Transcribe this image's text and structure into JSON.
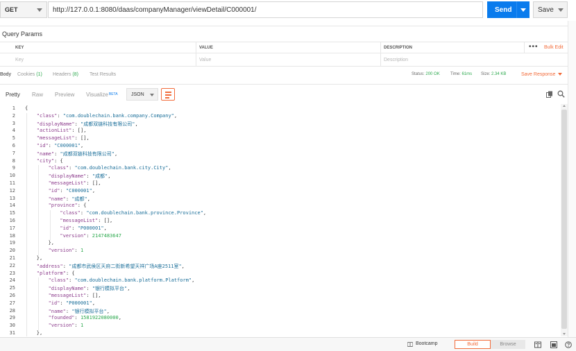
{
  "request": {
    "method": "GET",
    "url": "http://127.0.0.1:8080/daas/companyManager/viewDetail/C000001/",
    "send_label": "Send",
    "save_label": "Save"
  },
  "params": {
    "title": "Query Params",
    "columns": [
      "KEY",
      "VALUE",
      "DESCRIPTION"
    ],
    "placeholders": [
      "Key",
      "Value",
      "Description"
    ],
    "more": "•••",
    "bulk_edit": "Bulk Edit"
  },
  "response_tabs": {
    "body": "Body",
    "cookies": "Cookies",
    "cookies_count": "(1)",
    "headers": "Headers",
    "headers_count": "(8)",
    "test_results": "Test Results"
  },
  "response_meta": {
    "status_label": "Status:",
    "status_value": "200 OK",
    "time_label": "Time:",
    "time_value": "61ms",
    "size_label": "Size:",
    "size_value": "2.34 KB",
    "save_response": "Save Response"
  },
  "view_modes": {
    "pretty": "Pretty",
    "raw": "Raw",
    "preview": "Preview",
    "visualize": "Visualize",
    "beta": "BETA",
    "format": "JSON"
  },
  "code_lines": [
    {
      "n": "1",
      "indent": 0,
      "parts": [
        [
          "p",
          "{"
        ]
      ]
    },
    {
      "n": "2",
      "indent": 1,
      "parts": [
        [
          "k",
          "\"class\""
        ],
        [
          "p",
          ": "
        ],
        [
          "s",
          "\"com.doublechain.bank.company.Company\""
        ],
        [
          "p",
          ","
        ]
      ]
    },
    {
      "n": "3",
      "indent": 1,
      "parts": [
        [
          "k",
          "\"displayName\""
        ],
        [
          "p",
          ": "
        ],
        [
          "s",
          "\"成都双链科技有限公司\""
        ],
        [
          "p",
          ","
        ]
      ]
    },
    {
      "n": "4",
      "indent": 1,
      "parts": [
        [
          "k",
          "\"actionList\""
        ],
        [
          "p",
          ": [],"
        ]
      ]
    },
    {
      "n": "5",
      "indent": 1,
      "parts": [
        [
          "k",
          "\"messageList\""
        ],
        [
          "p",
          ": [],"
        ]
      ]
    },
    {
      "n": "6",
      "indent": 1,
      "parts": [
        [
          "k",
          "\"id\""
        ],
        [
          "p",
          ": "
        ],
        [
          "s",
          "\"C000001\""
        ],
        [
          "p",
          ","
        ]
      ]
    },
    {
      "n": "7",
      "indent": 1,
      "parts": [
        [
          "k",
          "\"name\""
        ],
        [
          "p",
          ": "
        ],
        [
          "s",
          "\"成都双链科技有限公司\""
        ],
        [
          "p",
          ","
        ]
      ]
    },
    {
      "n": "8",
      "indent": 1,
      "parts": [
        [
          "k",
          "\"city\""
        ],
        [
          "p",
          ": {"
        ]
      ]
    },
    {
      "n": "9",
      "indent": 2,
      "parts": [
        [
          "k",
          "\"class\""
        ],
        [
          "p",
          ": "
        ],
        [
          "s",
          "\"com.doublechain.bank.city.City\""
        ],
        [
          "p",
          ","
        ]
      ]
    },
    {
      "n": "10",
      "indent": 2,
      "parts": [
        [
          "k",
          "\"displayName\""
        ],
        [
          "p",
          ": "
        ],
        [
          "s",
          "\"成都\""
        ],
        [
          "p",
          ","
        ]
      ]
    },
    {
      "n": "11",
      "indent": 2,
      "parts": [
        [
          "k",
          "\"messageList\""
        ],
        [
          "p",
          ": [],"
        ]
      ]
    },
    {
      "n": "12",
      "indent": 2,
      "parts": [
        [
          "k",
          "\"id\""
        ],
        [
          "p",
          ": "
        ],
        [
          "s",
          "\"C000001\""
        ],
        [
          "p",
          ","
        ]
      ]
    },
    {
      "n": "13",
      "indent": 2,
      "parts": [
        [
          "k",
          "\"name\""
        ],
        [
          "p",
          ": "
        ],
        [
          "s",
          "\"成都\""
        ],
        [
          "p",
          ","
        ]
      ]
    },
    {
      "n": "14",
      "indent": 2,
      "parts": [
        [
          "k",
          "\"province\""
        ],
        [
          "p",
          ": {"
        ]
      ]
    },
    {
      "n": "15",
      "indent": 3,
      "parts": [
        [
          "k",
          "\"class\""
        ],
        [
          "p",
          ": "
        ],
        [
          "s",
          "\"com.doublechain.bank.province.Province\""
        ],
        [
          "p",
          ","
        ]
      ]
    },
    {
      "n": "16",
      "indent": 3,
      "parts": [
        [
          "k",
          "\"messageList\""
        ],
        [
          "p",
          ": [],"
        ]
      ]
    },
    {
      "n": "17",
      "indent": 3,
      "parts": [
        [
          "k",
          "\"id\""
        ],
        [
          "p",
          ": "
        ],
        [
          "s",
          "\"P000001\""
        ],
        [
          "p",
          ","
        ]
      ]
    },
    {
      "n": "18",
      "indent": 3,
      "parts": [
        [
          "k",
          "\"version\""
        ],
        [
          "p",
          ": "
        ],
        [
          "n",
          "2147483647"
        ]
      ]
    },
    {
      "n": "19",
      "indent": 2,
      "parts": [
        [
          "p",
          "},"
        ]
      ]
    },
    {
      "n": "20",
      "indent": 2,
      "parts": [
        [
          "k",
          "\"version\""
        ],
        [
          "p",
          ": "
        ],
        [
          "n",
          "1"
        ]
      ]
    },
    {
      "n": "21",
      "indent": 1,
      "parts": [
        [
          "p",
          "},"
        ]
      ]
    },
    {
      "n": "22",
      "indent": 1,
      "parts": [
        [
          "k",
          "\"address\""
        ],
        [
          "p",
          ": "
        ],
        [
          "s",
          "\"成都市武侯区天府二街新希望天祥广场A座2511室\""
        ],
        [
          "p",
          ","
        ]
      ]
    },
    {
      "n": "23",
      "indent": 1,
      "parts": [
        [
          "k",
          "\"platform\""
        ],
        [
          "p",
          ": {"
        ]
      ]
    },
    {
      "n": "24",
      "indent": 2,
      "parts": [
        [
          "k",
          "\"class\""
        ],
        [
          "p",
          ": "
        ],
        [
          "s",
          "\"com.doublechain.bank.platform.Platform\""
        ],
        [
          "p",
          ","
        ]
      ]
    },
    {
      "n": "25",
      "indent": 2,
      "parts": [
        [
          "k",
          "\"displayName\""
        ],
        [
          "p",
          ": "
        ],
        [
          "s",
          "\"银行模拟平台\""
        ],
        [
          "p",
          ","
        ]
      ]
    },
    {
      "n": "26",
      "indent": 2,
      "parts": [
        [
          "k",
          "\"messageList\""
        ],
        [
          "p",
          ": [],"
        ]
      ]
    },
    {
      "n": "27",
      "indent": 2,
      "parts": [
        [
          "k",
          "\"id\""
        ],
        [
          "p",
          ": "
        ],
        [
          "s",
          "\"P000001\""
        ],
        [
          "p",
          ","
        ]
      ]
    },
    {
      "n": "28",
      "indent": 2,
      "parts": [
        [
          "k",
          "\"name\""
        ],
        [
          "p",
          ": "
        ],
        [
          "s",
          "\"银行模拟平台\""
        ],
        [
          "p",
          ","
        ]
      ]
    },
    {
      "n": "29",
      "indent": 2,
      "parts": [
        [
          "k",
          "\"founded\""
        ],
        [
          "p",
          ": "
        ],
        [
          "n",
          "1581922080000"
        ],
        [
          "p",
          ","
        ]
      ]
    },
    {
      "n": "30",
      "indent": 2,
      "parts": [
        [
          "k",
          "\"version\""
        ],
        [
          "p",
          ": "
        ],
        [
          "n",
          "1"
        ]
      ]
    },
    {
      "n": "31",
      "indent": 1,
      "parts": [
        [
          "p",
          "},"
        ]
      ]
    }
  ],
  "statusbar": {
    "bootcamp": "Bootcamp",
    "build": "Build",
    "browse": "Browse"
  },
  "colors": {
    "accent": "#f26b3a",
    "send": "#097bed",
    "status_ok": "#2aa84c"
  }
}
